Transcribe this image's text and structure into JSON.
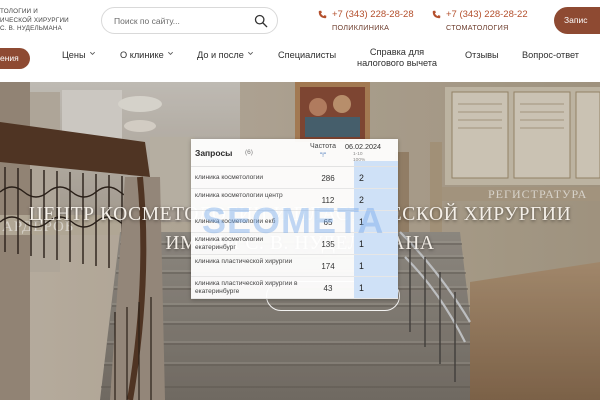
{
  "header": {
    "logo_lines": [
      "ТОЛОГИИ И",
      "ИЧЕСКОЙ ХИРУРГИИ",
      "С. В. НУДЕЛЬМАНА"
    ],
    "search_placeholder": "Поиск по сайту...",
    "phones": [
      {
        "number": "+7 (343) 228-28-28",
        "label": "ПОЛИКЛИНИКА"
      },
      {
        "number": "+7 (343) 228-28-22",
        "label": "СТОМАТОЛОГИЯ"
      }
    ],
    "cta_right_label": "Запис",
    "cta_left_label": "ения",
    "accent_color": "#8e4a32",
    "phone_color": "#b4502d"
  },
  "nav": {
    "items": [
      {
        "label": "Цены",
        "has_dropdown": true
      },
      {
        "label": "О клинике",
        "has_dropdown": true
      },
      {
        "label": "До и после",
        "has_dropdown": true
      },
      {
        "label": "Специалисты",
        "has_dropdown": false
      },
      {
        "label_line1": "Справка для",
        "label_line2": "налогового вычета",
        "has_dropdown": false
      },
      {
        "label": "Отзывы",
        "has_dropdown": false
      },
      {
        "label": "Вопрос-ответ",
        "has_dropdown": false
      }
    ]
  },
  "hero": {
    "title_line1": "ЦЕНТР КОСМЕТОЛОГИИ И ПЛАСТИЧЕСКОЙ ХИРУРГИИ",
    "title_line2": "ИМЕНИ С. В. НУДЕЛЬМАНА",
    "watermark": "SEOMETA",
    "wall_sign_left": "АРДЕРОБ",
    "wall_sign_right": "РЕГИСТРАТУРА"
  },
  "keywords_panel": {
    "title": "Запросы",
    "count": "(6)",
    "freq_header": "Частота",
    "freq_sub": "\"!\"",
    "date_header": "06.02.2024",
    "range_top": "1-10",
    "range_bottom": "100%",
    "highlight_color": "#cfe1f7",
    "rows": [
      {
        "query": "клиника косметологии",
        "frequency": "286",
        "position": "2"
      },
      {
        "query": "клиника косметологии центр",
        "frequency": "112",
        "position": "2"
      },
      {
        "query": "клиника косметологии екб",
        "frequency": "65",
        "position": "1"
      },
      {
        "query": "клиника косметологии екатеринбург",
        "frequency": "135",
        "position": "1"
      },
      {
        "query": "клиника пластической хирургии",
        "frequency": "174",
        "position": "1"
      },
      {
        "query": "клиника пластической хирургии в екатеринбурге",
        "frequency": "43",
        "position": "1"
      }
    ]
  }
}
